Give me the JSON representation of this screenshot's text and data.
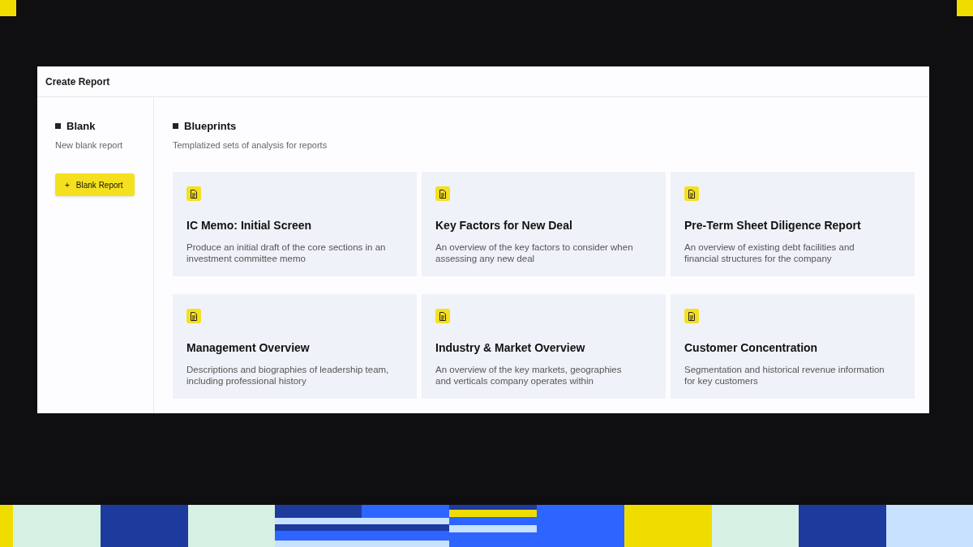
{
  "window": {
    "title": "Create Report"
  },
  "blank": {
    "title": "Blank",
    "subtitle": "New blank report",
    "button": {
      "icon": "+",
      "label": "Blank Report"
    }
  },
  "blueprints": {
    "title": "Blueprints",
    "subtitle": "Templatized sets of analysis for reports",
    "cards": [
      {
        "title": "IC Memo: Initial Screen",
        "description": "Produce an initial draft of the core sections in an investment committee memo"
      },
      {
        "title": "Key Factors for New Deal",
        "description": "An overview of the key factors to consider when assessing any new deal"
      },
      {
        "title": "Pre-Term Sheet Diligence Report",
        "description": "An overview of existing debt facilities and financial structures for the company"
      },
      {
        "title": "Management Overview",
        "description": "Descriptions and biographies of leadership team, including professional history"
      },
      {
        "title": "Industry & Market Overview",
        "description": "An overview of the key markets, geographies and verticals company operates within"
      },
      {
        "title": "Customer Concentration",
        "description": "Segmentation and historical revenue information for key customers"
      }
    ]
  }
}
